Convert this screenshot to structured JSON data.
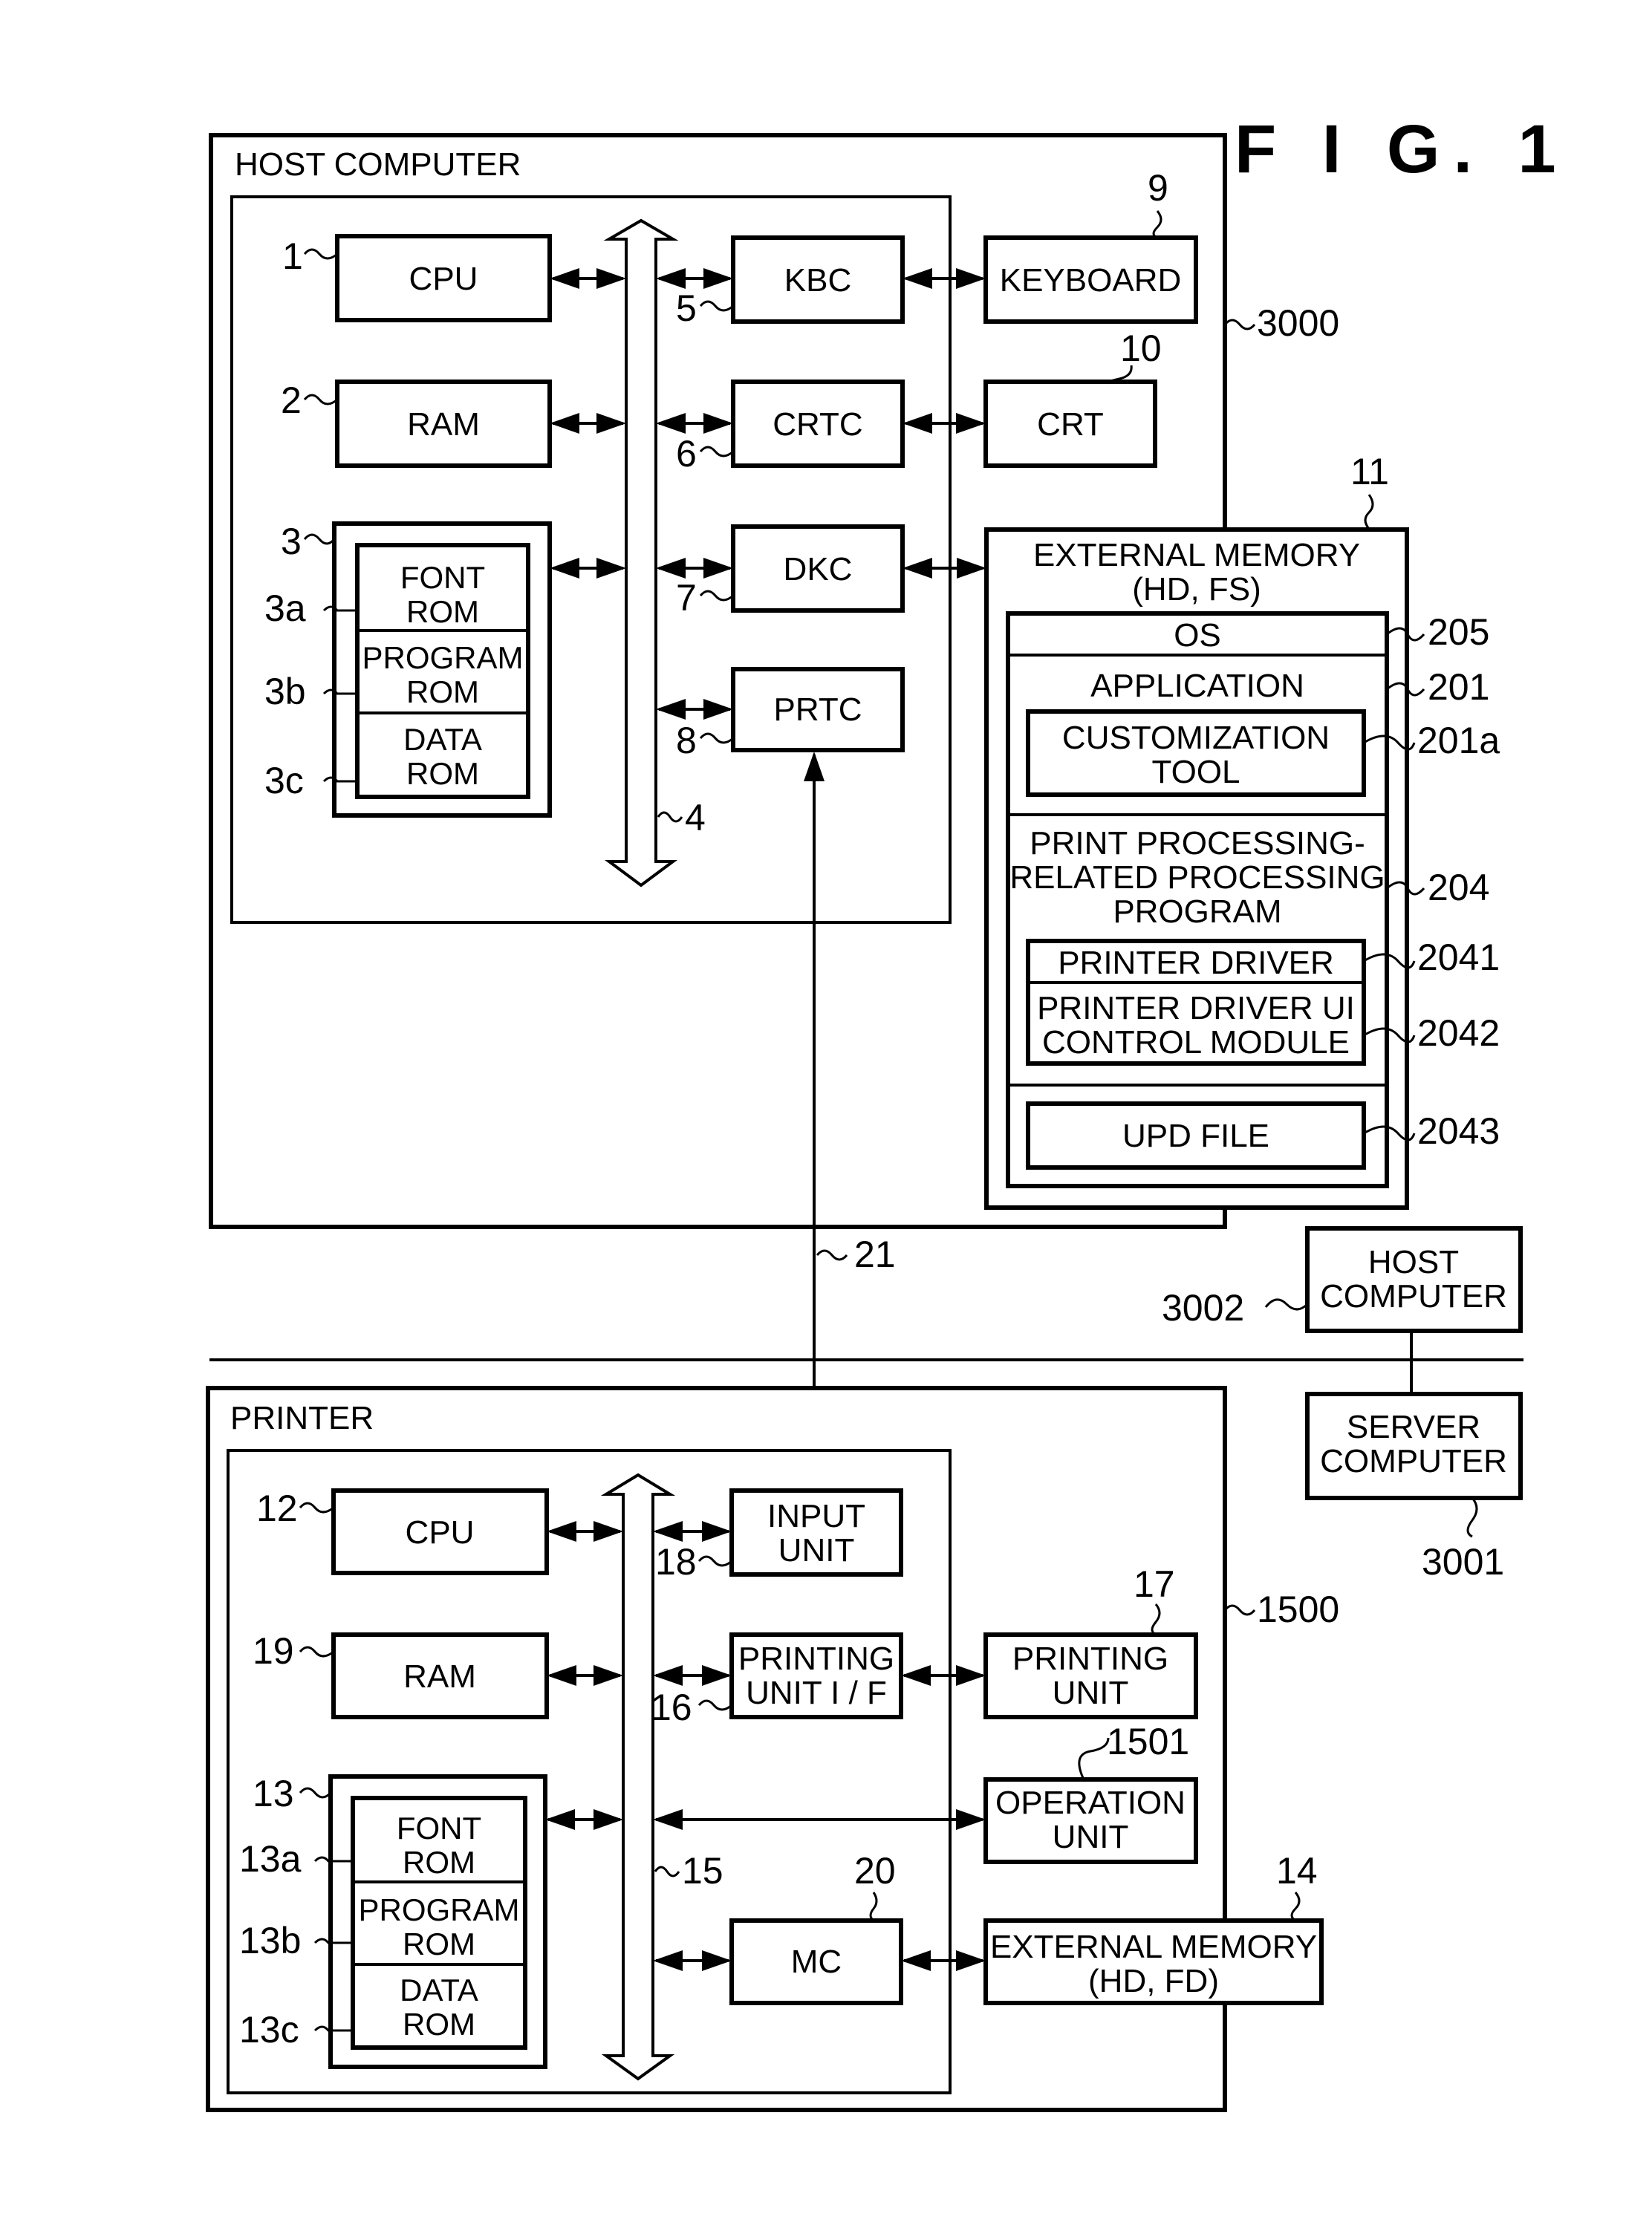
{
  "figure": {
    "title": "F I G.  1"
  },
  "host_computer": {
    "title": "HOST COMPUTER",
    "ref": "3000",
    "cpu": {
      "label": "CPU",
      "ref": "1"
    },
    "ram": {
      "label": "RAM",
      "ref": "2"
    },
    "rom": {
      "ref": "3",
      "font_rom": [
        "FONT",
        "ROM"
      ],
      "font_ref": "3a",
      "program_rom": [
        "PROGRAM",
        "ROM"
      ],
      "program_ref": "3b",
      "data_rom": [
        "DATA",
        "ROM"
      ],
      "data_ref": "3c"
    },
    "bus_ref": "4",
    "kbc": {
      "label": "KBC",
      "ref": "5"
    },
    "crtc": {
      "label": "CRTC",
      "ref": "6"
    },
    "dkc": {
      "label": "DKC",
      "ref": "7"
    },
    "prtc": {
      "label": "PRTC",
      "ref": "8"
    },
    "keyboard": {
      "label": "KEYBOARD",
      "ref": "9"
    },
    "crt": {
      "label": "CRT",
      "ref": "10"
    },
    "external_memory": {
      "ref": "11",
      "title": [
        "EXTERNAL MEMORY",
        "(HD, FS)"
      ],
      "os": {
        "label": "OS",
        "ref": "205"
      },
      "application": {
        "label": "APPLICATION",
        "ref": "201"
      },
      "customization_tool": {
        "label": [
          "CUSTOMIZATION",
          "TOOL"
        ],
        "ref": "201a"
      },
      "print_program": {
        "label": [
          "PRINT PROCESSING-",
          "RELATED PROCESSING",
          "PROGRAM"
        ],
        "ref": "204"
      },
      "printer_driver": {
        "label": "PRINTER DRIVER",
        "ref": "2041"
      },
      "printer_driver_ui": {
        "label": [
          "PRINTER DRIVER UI",
          "CONTROL MODULE"
        ],
        "ref": "2042"
      },
      "upd_file": {
        "label": "UPD FILE",
        "ref": "2043"
      }
    }
  },
  "connection": {
    "ref": "21"
  },
  "host_computer_2": {
    "label": [
      "HOST",
      "COMPUTER"
    ],
    "ref": "3002"
  },
  "server_computer": {
    "label": [
      "SERVER",
      "COMPUTER"
    ],
    "ref": "3001"
  },
  "printer": {
    "title": "PRINTER",
    "ref": "1500",
    "cpu": {
      "label": "CPU",
      "ref": "12"
    },
    "ram": {
      "label": "RAM",
      "ref": "19"
    },
    "rom": {
      "ref": "13",
      "font_rom": [
        "FONT",
        "ROM"
      ],
      "font_ref": "13a",
      "program_rom": [
        "PROGRAM",
        "ROM"
      ],
      "program_ref": "13b",
      "data_rom": [
        "DATA",
        "ROM"
      ],
      "data_ref": "13c"
    },
    "bus_ref": "15",
    "input_unit": {
      "label": [
        "INPUT",
        "UNIT"
      ],
      "ref": "18"
    },
    "printing_unit_if": {
      "label": [
        "PRINTING",
        "UNIT I / F"
      ],
      "ref": "16"
    },
    "mc": {
      "label": "MC",
      "ref": "20"
    },
    "printing_unit": {
      "label": [
        "PRINTING",
        "UNIT"
      ],
      "ref": "17"
    },
    "operation_unit": {
      "label": [
        "OPERATION",
        "UNIT"
      ],
      "ref": "1501"
    },
    "external_memory": {
      "label": [
        "EXTERNAL MEMORY",
        "(HD, FD)"
      ],
      "ref": "14"
    }
  }
}
